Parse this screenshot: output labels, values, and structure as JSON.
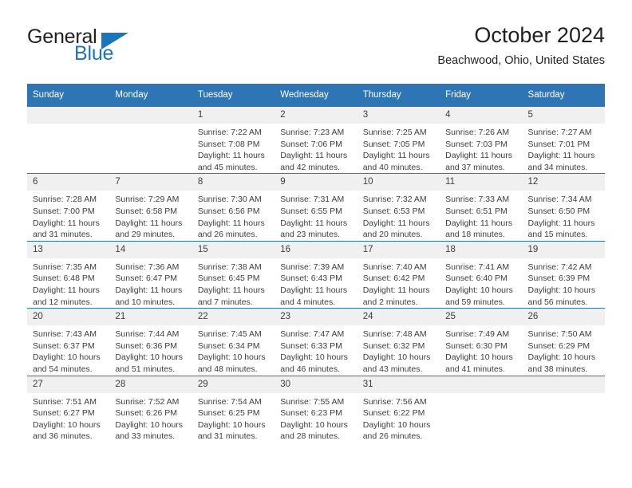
{
  "brand": {
    "name_top": "General",
    "name_bottom": "Blue",
    "accent_color": "#1b75bb"
  },
  "header": {
    "title": "October 2024",
    "subtitle": "Beachwood, Ohio, United States"
  },
  "calendar": {
    "header_background": "#2e75b6",
    "daynum_background": "#f0f0f0",
    "weekdays": [
      "Sunday",
      "Monday",
      "Tuesday",
      "Wednesday",
      "Thursday",
      "Friday",
      "Saturday"
    ],
    "weeks": [
      [
        {
          "day": "",
          "sunrise": "",
          "sunset": "",
          "daylight_1": "",
          "daylight_2": ""
        },
        {
          "day": "",
          "sunrise": "",
          "sunset": "",
          "daylight_1": "",
          "daylight_2": ""
        },
        {
          "day": "1",
          "sunrise": "Sunrise: 7:22 AM",
          "sunset": "Sunset: 7:08 PM",
          "daylight_1": "Daylight: 11 hours",
          "daylight_2": "and 45 minutes."
        },
        {
          "day": "2",
          "sunrise": "Sunrise: 7:23 AM",
          "sunset": "Sunset: 7:06 PM",
          "daylight_1": "Daylight: 11 hours",
          "daylight_2": "and 42 minutes."
        },
        {
          "day": "3",
          "sunrise": "Sunrise: 7:25 AM",
          "sunset": "Sunset: 7:05 PM",
          "daylight_1": "Daylight: 11 hours",
          "daylight_2": "and 40 minutes."
        },
        {
          "day": "4",
          "sunrise": "Sunrise: 7:26 AM",
          "sunset": "Sunset: 7:03 PM",
          "daylight_1": "Daylight: 11 hours",
          "daylight_2": "and 37 minutes."
        },
        {
          "day": "5",
          "sunrise": "Sunrise: 7:27 AM",
          "sunset": "Sunset: 7:01 PM",
          "daylight_1": "Daylight: 11 hours",
          "daylight_2": "and 34 minutes."
        }
      ],
      [
        {
          "day": "6",
          "sunrise": "Sunrise: 7:28 AM",
          "sunset": "Sunset: 7:00 PM",
          "daylight_1": "Daylight: 11 hours",
          "daylight_2": "and 31 minutes."
        },
        {
          "day": "7",
          "sunrise": "Sunrise: 7:29 AM",
          "sunset": "Sunset: 6:58 PM",
          "daylight_1": "Daylight: 11 hours",
          "daylight_2": "and 29 minutes."
        },
        {
          "day": "8",
          "sunrise": "Sunrise: 7:30 AM",
          "sunset": "Sunset: 6:56 PM",
          "daylight_1": "Daylight: 11 hours",
          "daylight_2": "and 26 minutes."
        },
        {
          "day": "9",
          "sunrise": "Sunrise: 7:31 AM",
          "sunset": "Sunset: 6:55 PM",
          "daylight_1": "Daylight: 11 hours",
          "daylight_2": "and 23 minutes."
        },
        {
          "day": "10",
          "sunrise": "Sunrise: 7:32 AM",
          "sunset": "Sunset: 6:53 PM",
          "daylight_1": "Daylight: 11 hours",
          "daylight_2": "and 20 minutes."
        },
        {
          "day": "11",
          "sunrise": "Sunrise: 7:33 AM",
          "sunset": "Sunset: 6:51 PM",
          "daylight_1": "Daylight: 11 hours",
          "daylight_2": "and 18 minutes."
        },
        {
          "day": "12",
          "sunrise": "Sunrise: 7:34 AM",
          "sunset": "Sunset: 6:50 PM",
          "daylight_1": "Daylight: 11 hours",
          "daylight_2": "and 15 minutes."
        }
      ],
      [
        {
          "day": "13",
          "sunrise": "Sunrise: 7:35 AM",
          "sunset": "Sunset: 6:48 PM",
          "daylight_1": "Daylight: 11 hours",
          "daylight_2": "and 12 minutes."
        },
        {
          "day": "14",
          "sunrise": "Sunrise: 7:36 AM",
          "sunset": "Sunset: 6:47 PM",
          "daylight_1": "Daylight: 11 hours",
          "daylight_2": "and 10 minutes."
        },
        {
          "day": "15",
          "sunrise": "Sunrise: 7:38 AM",
          "sunset": "Sunset: 6:45 PM",
          "daylight_1": "Daylight: 11 hours",
          "daylight_2": "and 7 minutes."
        },
        {
          "day": "16",
          "sunrise": "Sunrise: 7:39 AM",
          "sunset": "Sunset: 6:43 PM",
          "daylight_1": "Daylight: 11 hours",
          "daylight_2": "and 4 minutes."
        },
        {
          "day": "17",
          "sunrise": "Sunrise: 7:40 AM",
          "sunset": "Sunset: 6:42 PM",
          "daylight_1": "Daylight: 11 hours",
          "daylight_2": "and 2 minutes."
        },
        {
          "day": "18",
          "sunrise": "Sunrise: 7:41 AM",
          "sunset": "Sunset: 6:40 PM",
          "daylight_1": "Daylight: 10 hours",
          "daylight_2": "and 59 minutes."
        },
        {
          "day": "19",
          "sunrise": "Sunrise: 7:42 AM",
          "sunset": "Sunset: 6:39 PM",
          "daylight_1": "Daylight: 10 hours",
          "daylight_2": "and 56 minutes."
        }
      ],
      [
        {
          "day": "20",
          "sunrise": "Sunrise: 7:43 AM",
          "sunset": "Sunset: 6:37 PM",
          "daylight_1": "Daylight: 10 hours",
          "daylight_2": "and 54 minutes."
        },
        {
          "day": "21",
          "sunrise": "Sunrise: 7:44 AM",
          "sunset": "Sunset: 6:36 PM",
          "daylight_1": "Daylight: 10 hours",
          "daylight_2": "and 51 minutes."
        },
        {
          "day": "22",
          "sunrise": "Sunrise: 7:45 AM",
          "sunset": "Sunset: 6:34 PM",
          "daylight_1": "Daylight: 10 hours",
          "daylight_2": "and 48 minutes."
        },
        {
          "day": "23",
          "sunrise": "Sunrise: 7:47 AM",
          "sunset": "Sunset: 6:33 PM",
          "daylight_1": "Daylight: 10 hours",
          "daylight_2": "and 46 minutes."
        },
        {
          "day": "24",
          "sunrise": "Sunrise: 7:48 AM",
          "sunset": "Sunset: 6:32 PM",
          "daylight_1": "Daylight: 10 hours",
          "daylight_2": "and 43 minutes."
        },
        {
          "day": "25",
          "sunrise": "Sunrise: 7:49 AM",
          "sunset": "Sunset: 6:30 PM",
          "daylight_1": "Daylight: 10 hours",
          "daylight_2": "and 41 minutes."
        },
        {
          "day": "26",
          "sunrise": "Sunrise: 7:50 AM",
          "sunset": "Sunset: 6:29 PM",
          "daylight_1": "Daylight: 10 hours",
          "daylight_2": "and 38 minutes."
        }
      ],
      [
        {
          "day": "27",
          "sunrise": "Sunrise: 7:51 AM",
          "sunset": "Sunset: 6:27 PM",
          "daylight_1": "Daylight: 10 hours",
          "daylight_2": "and 36 minutes."
        },
        {
          "day": "28",
          "sunrise": "Sunrise: 7:52 AM",
          "sunset": "Sunset: 6:26 PM",
          "daylight_1": "Daylight: 10 hours",
          "daylight_2": "and 33 minutes."
        },
        {
          "day": "29",
          "sunrise": "Sunrise: 7:54 AM",
          "sunset": "Sunset: 6:25 PM",
          "daylight_1": "Daylight: 10 hours",
          "daylight_2": "and 31 minutes."
        },
        {
          "day": "30",
          "sunrise": "Sunrise: 7:55 AM",
          "sunset": "Sunset: 6:23 PM",
          "daylight_1": "Daylight: 10 hours",
          "daylight_2": "and 28 minutes."
        },
        {
          "day": "31",
          "sunrise": "Sunrise: 7:56 AM",
          "sunset": "Sunset: 6:22 PM",
          "daylight_1": "Daylight: 10 hours",
          "daylight_2": "and 26 minutes."
        },
        {
          "day": "",
          "sunrise": "",
          "sunset": "",
          "daylight_1": "",
          "daylight_2": ""
        },
        {
          "day": "",
          "sunrise": "",
          "sunset": "",
          "daylight_1": "",
          "daylight_2": ""
        }
      ]
    ]
  }
}
